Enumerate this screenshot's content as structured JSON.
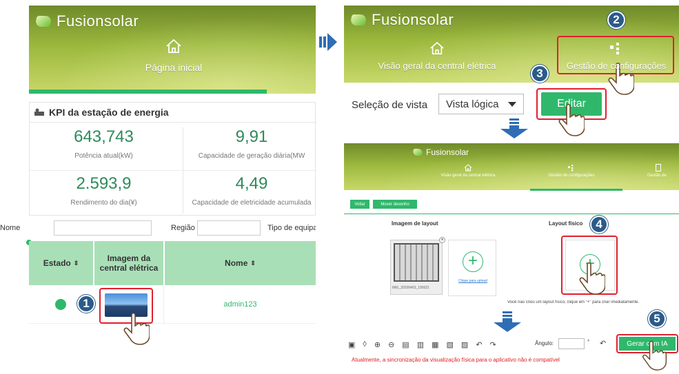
{
  "panel1": {
    "app_title": "Fusionsolar",
    "nav_home": "Página inicial",
    "kpi_title": "KPI da estação de energia",
    "kpis": [
      {
        "value": "643,743",
        "label": "Potência atual(kW)"
      },
      {
        "value": "9,91",
        "label": "Capacidade de geração diária(MW"
      },
      {
        "value": "2.593,9",
        "label": "Rendimento do dia(¥)"
      },
      {
        "value": "4,49",
        "label": "Capacidade de eletricidade acumulada"
      }
    ],
    "filter_name_label": "Nome",
    "filter_region_label": "Região",
    "filter_type_label": "Tipo de equipa",
    "table_headers": {
      "state": "Estado",
      "image": "Imagem da central elétrica",
      "name": "Nome"
    },
    "row": {
      "name": "admin123"
    },
    "sort_glyph": "⇕"
  },
  "panel2": {
    "app_title": "Fusionsolar",
    "nav_overview": "Visão geral da central elétrica",
    "nav_config": "Gestão de configurações",
    "view_select_label": "Seleção de vista",
    "view_select_value": "Vista lógica",
    "edit_button": "Editar"
  },
  "panel3": {
    "app_title": "Fusionsolar",
    "nav_overview": "Visão geral da central elétrica",
    "nav_config": "Gestão de configurações",
    "nav_third": "Gestão de",
    "btn_back": "Voltar",
    "btn_move": "Mover desenho",
    "layout_image_title": "Imagem de layout",
    "physical_layout_title": "Layout físico",
    "thumb_caption": "IMG_20200403_195021",
    "upload_link": "Clique para upload",
    "create_hint": "Você não criou um layout físico, clique em \"+\" para criar imediatamente.",
    "angle_label": "Ângulo:",
    "angle_unit": "°",
    "ai_button": "Gerar com IA",
    "warning": "Atualmente, a sincronização da visualização física para o aplicativo não é compatível"
  },
  "steps": [
    "1",
    "2",
    "3",
    "4",
    "5"
  ],
  "colors": {
    "accent_green": "#2fb86b",
    "step_badge": "#2b5b8a",
    "highlight_red": "#e0202f",
    "arrow_blue": "#2f6db5",
    "warning_red": "#e02020"
  }
}
